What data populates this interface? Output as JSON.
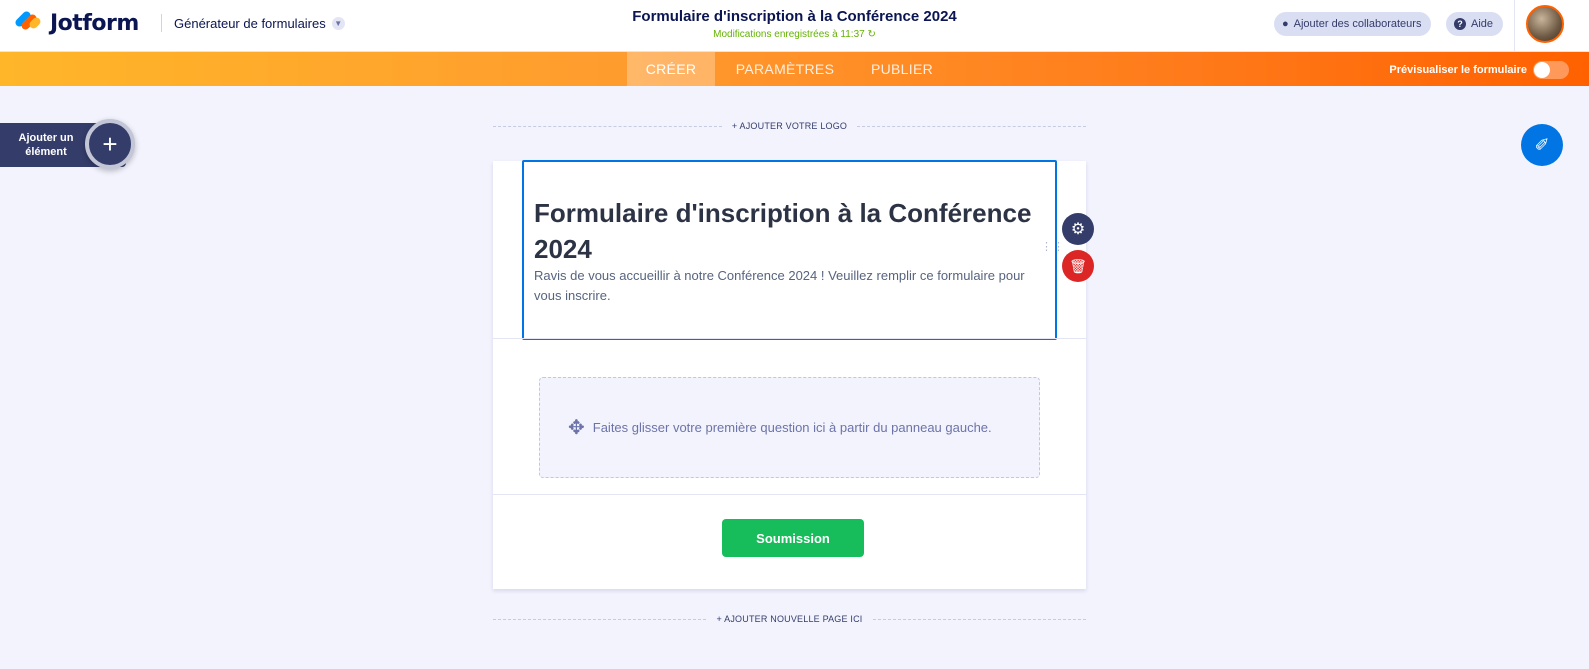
{
  "app": {
    "brand": "Jotform",
    "builder_menu": "Générateur de formulaires",
    "form_title": "Formulaire d'inscription à la Conférence 2024",
    "save_status": "Modifications enregistrées à 11:37",
    "collaborators_button": "Ajouter des collaborateurs",
    "help_button": "Aide"
  },
  "tabs": [
    {
      "label": "CRÉER",
      "active": true
    },
    {
      "label": "PARAMÈTRES",
      "active": false
    },
    {
      "label": "PUBLIER",
      "active": false
    }
  ],
  "preview_label": "Prévisualiser le formulaire",
  "add_element_label": "Ajouter un élément",
  "add_logo_label": "+ AJOUTER VOTRE LOGO",
  "add_page_label": "+ AJOUTER NOUVELLE PAGE ICI",
  "form": {
    "heading": "Formulaire d'inscription à la Conférence 2024",
    "subheading": "Ravis de vous accueillir à notre Conférence 2024 ! Veuillez remplir ce formulaire pour vous inscrire.",
    "dropzone_text": "Faites glisser votre première question ici à partir du panneau gauche.",
    "submit_label": "Soumission"
  },
  "icons": {
    "gear": "gear-icon",
    "trash": "trash-icon",
    "move": "move-icon",
    "plus": "plus-icon",
    "paint": "paint-roller-icon",
    "user": "user-icon",
    "help": "question-icon",
    "refresh": "refresh-icon",
    "chevron": "chevron-down-icon"
  },
  "colors": {
    "brand_navy": "#0a1551",
    "accent_orange": "#ff6100",
    "accent_blue": "#0075e3",
    "submit_green": "#18bd5b",
    "delete_red": "#dc2626"
  }
}
